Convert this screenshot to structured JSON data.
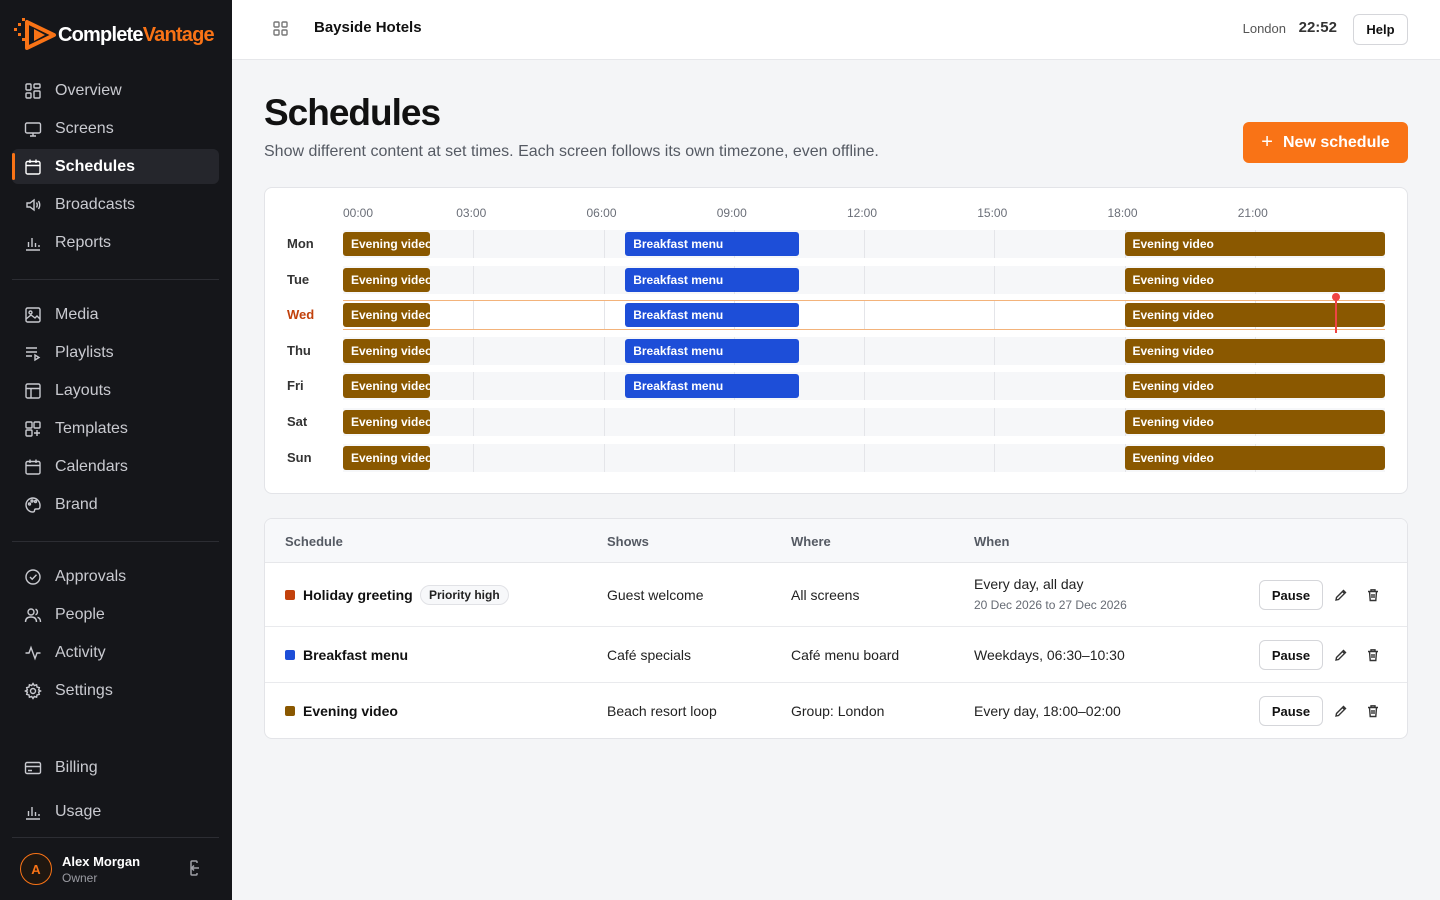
{
  "brand": {
    "name_a": "Complete",
    "name_b": "Vantage",
    "accent": "#f97316"
  },
  "sidebar": {
    "group1": [
      {
        "label": "Overview",
        "icon": "grid-icon"
      },
      {
        "label": "Screens",
        "icon": "monitor-icon"
      },
      {
        "label": "Schedules",
        "icon": "calendar-icon",
        "active": true
      },
      {
        "label": "Broadcasts",
        "icon": "speaker-icon"
      },
      {
        "label": "Reports",
        "icon": "bar-chart-icon"
      }
    ],
    "group2": [
      {
        "label": "Media",
        "icon": "image-icon"
      },
      {
        "label": "Playlists",
        "icon": "playlist-icon"
      },
      {
        "label": "Layouts",
        "icon": "layout-icon"
      },
      {
        "label": "Templates",
        "icon": "template-icon"
      },
      {
        "label": "Calendars",
        "icon": "calendar-icon"
      },
      {
        "label": "Brand",
        "icon": "palette-icon"
      }
    ],
    "group3": [
      {
        "label": "Approvals",
        "icon": "check-circle-icon"
      },
      {
        "label": "People",
        "icon": "people-icon"
      },
      {
        "label": "Activity",
        "icon": "activity-icon"
      },
      {
        "label": "Settings",
        "icon": "gear-icon"
      }
    ],
    "group4": [
      {
        "label": "Billing",
        "icon": "card-icon"
      },
      {
        "label": "Usage",
        "icon": "bar-chart-icon"
      }
    ],
    "user": {
      "initial": "A",
      "name": "Alex Morgan",
      "role": "Owner"
    }
  },
  "header": {
    "org": "Bayside Hotels",
    "city": "London",
    "time": "22:52",
    "help": "Help"
  },
  "page": {
    "title": "Schedules",
    "subtitle": "Show different content at set times. Each screen follows its own timezone, even offline.",
    "new_button": "New schedule"
  },
  "timeline": {
    "hours": [
      "00:00",
      "03:00",
      "06:00",
      "09:00",
      "12:00",
      "15:00",
      "18:00",
      "21:00"
    ],
    "days": [
      {
        "label": "Mon",
        "breakfast": true
      },
      {
        "label": "Tue",
        "breakfast": true
      },
      {
        "label": "Wed",
        "breakfast": true,
        "today": true
      },
      {
        "label": "Thu",
        "breakfast": true
      },
      {
        "label": "Fri",
        "breakfast": true
      },
      {
        "label": "Sat",
        "breakfast": false
      },
      {
        "label": "Sun",
        "breakfast": false
      }
    ],
    "now": "22:52",
    "block_labels": {
      "evening": "Evening video",
      "breakfast": "Breakfast menu"
    },
    "colors": {
      "evening": "#8a5800",
      "breakfast": "#1d4ed8",
      "holiday": "#c2410c",
      "now": "#ef4444"
    }
  },
  "table": {
    "headers": {
      "schedule": "Schedule",
      "shows": "Shows",
      "where": "Where",
      "when": "When"
    },
    "rows": [
      {
        "name": "Holiday greeting",
        "badge": "Priority high",
        "shows": "Guest welcome",
        "where": "All screens",
        "when": "Every day, all day",
        "when_sub": "20 Dec 2026 to 27 Dec 2026",
        "color": "#c2410c",
        "action": "Pause"
      },
      {
        "name": "Breakfast menu",
        "badge": "",
        "shows": "Café specials",
        "where": "Café menu board",
        "when": "Weekdays, 06:30–10:30",
        "when_sub": "",
        "color": "#1d4ed8",
        "action": "Pause"
      },
      {
        "name": "Evening video",
        "badge": "",
        "shows": "Beach resort loop",
        "where": "Group: London",
        "when": "Every day, 18:00–02:00",
        "when_sub": "",
        "color": "#8a5800",
        "action": "Pause"
      }
    ]
  }
}
